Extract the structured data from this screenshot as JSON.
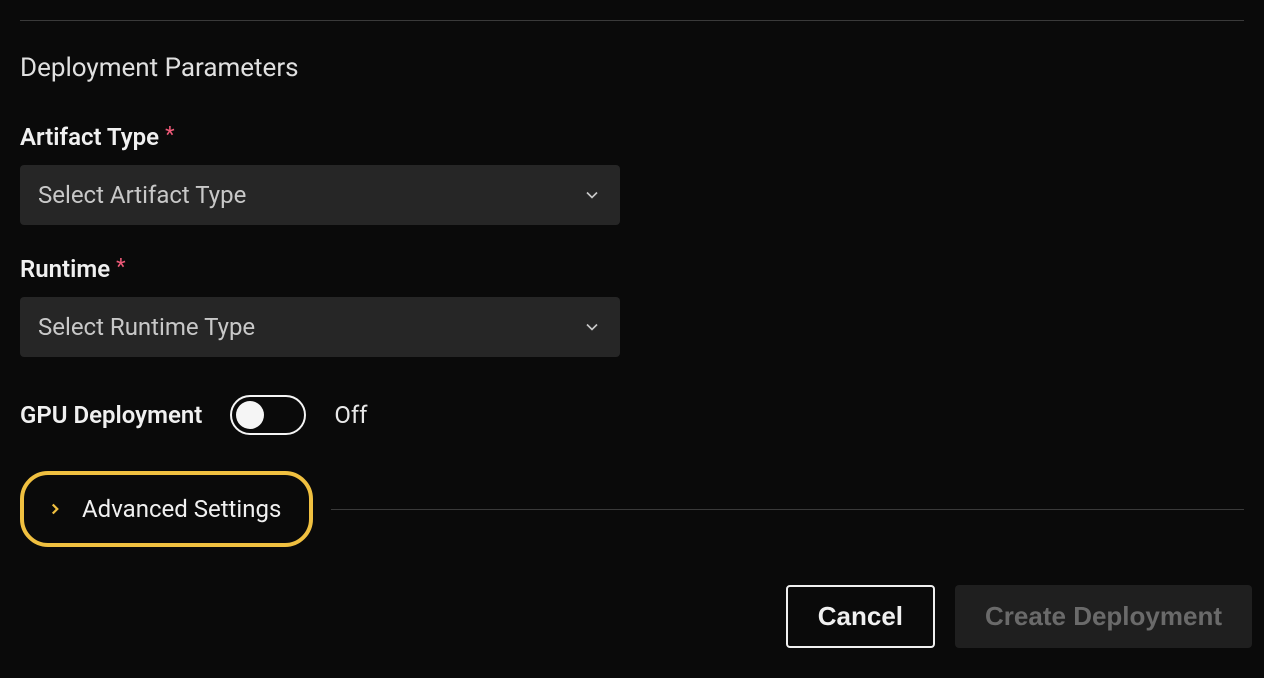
{
  "section": {
    "heading": "Deployment Parameters"
  },
  "fields": {
    "artifactType": {
      "label": "Artifact Type",
      "required": "*",
      "placeholder": "Select Artifact Type"
    },
    "runtime": {
      "label": "Runtime",
      "required": "*",
      "placeholder": "Select Runtime Type"
    },
    "gpu": {
      "label": "GPU Deployment",
      "state": "Off"
    }
  },
  "advanced": {
    "label": "Advanced Settings"
  },
  "buttons": {
    "cancel": "Cancel",
    "create": "Create Deployment"
  }
}
